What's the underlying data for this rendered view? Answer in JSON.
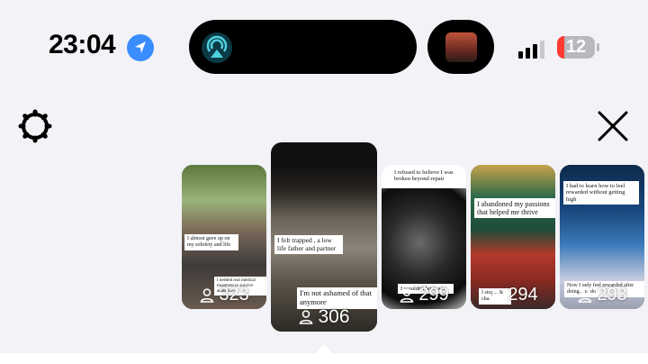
{
  "status_bar": {
    "time": "23:04",
    "battery_percent": "12",
    "signal_bars_filled": 3
  },
  "toolbar": {
    "settings_icon": "gear-icon",
    "close_icon": "close-icon"
  },
  "reels": [
    {
      "captions": [
        "I almost gave up on my sobriety and life",
        "I needed real medical treatment to survive addiction"
      ],
      "count": "323"
    },
    {
      "captions": [
        "I felt trapped , a low life father and partner",
        "I'm not ashamed of that anymore"
      ],
      "count": "306"
    },
    {
      "captions": [
        "I refused to believe I was broken beyond repair",
        "I wouldn't let it win"
      ],
      "count": "299"
    },
    {
      "captions": [
        "I abandoned my passions that helped me thrive",
        "I stop... & cha..."
      ],
      "count": "294"
    },
    {
      "captions": [
        "I had to learn how to feel rewarded without getting high",
        "Now I only feel rewarded after doing... to do"
      ],
      "count": "293"
    }
  ]
}
